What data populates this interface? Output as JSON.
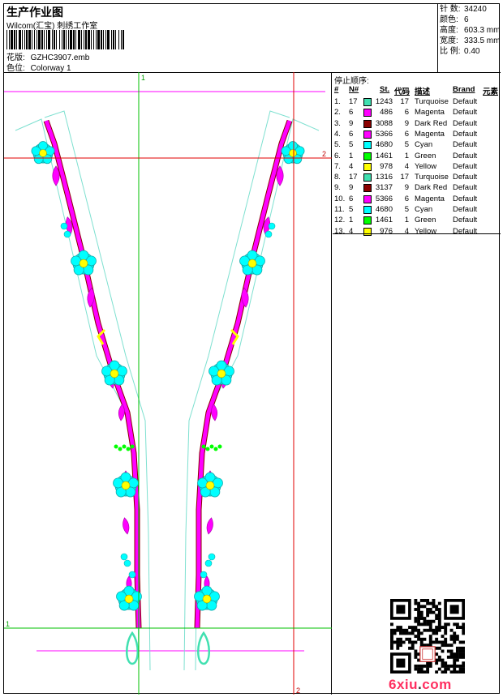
{
  "header": {
    "title": "生产作业图",
    "subtitle": "Wilcom(汇宝) 刺绣工作室",
    "design_label": "花版:",
    "design_value": "GZHC3907.emb",
    "colorway_label": "色位:",
    "colorway_value": "Colorway 1"
  },
  "stats": [
    {
      "label": "针 数:",
      "value": "34240"
    },
    {
      "label": "颜色:",
      "value": "6"
    },
    {
      "label": "高度:",
      "value": "603.3 mm"
    },
    {
      "label": "宽度:",
      "value": "333.5 mm"
    },
    {
      "label": "比 例:",
      "value": "0.40"
    }
  ],
  "stop_sequence": {
    "title": "停止顺序:",
    "columns": [
      "#",
      "N#",
      "St.",
      "代码",
      "描述",
      "Brand",
      "元素"
    ],
    "rows": [
      {
        "idx": "1.",
        "n": "17",
        "color": "#40e0b0",
        "st": "1243",
        "code": "17",
        "desc": "Turquoise",
        "brand": "Default"
      },
      {
        "idx": "2.",
        "n": "6",
        "color": "#ff00ff",
        "st": "486",
        "code": "6",
        "desc": "Magenta",
        "brand": "Default"
      },
      {
        "idx": "3.",
        "n": "9",
        "color": "#8b0000",
        "st": "3088",
        "code": "9",
        "desc": "Dark Red",
        "brand": "Default"
      },
      {
        "idx": "4.",
        "n": "6",
        "color": "#ff00ff",
        "st": "5366",
        "code": "6",
        "desc": "Magenta",
        "brand": "Default"
      },
      {
        "idx": "5.",
        "n": "5",
        "color": "#00ffff",
        "st": "4680",
        "code": "5",
        "desc": "Cyan",
        "brand": "Default"
      },
      {
        "idx": "6.",
        "n": "1",
        "color": "#00ff00",
        "st": "1461",
        "code": "1",
        "desc": "Green",
        "brand": "Default"
      },
      {
        "idx": "7.",
        "n": "4",
        "color": "#ffff00",
        "st": "978",
        "code": "4",
        "desc": "Yellow",
        "brand": "Default"
      },
      {
        "idx": "8.",
        "n": "17",
        "color": "#40e0b0",
        "st": "1316",
        "code": "17",
        "desc": "Turquoise",
        "brand": "Default"
      },
      {
        "idx": "9.",
        "n": "9",
        "color": "#8b0000",
        "st": "3137",
        "code": "9",
        "desc": "Dark Red",
        "brand": "Default"
      },
      {
        "idx": "10.",
        "n": "6",
        "color": "#ff00ff",
        "st": "5366",
        "code": "6",
        "desc": "Magenta",
        "brand": "Default"
      },
      {
        "idx": "11.",
        "n": "5",
        "color": "#00ffff",
        "st": "4680",
        "code": "5",
        "desc": "Cyan",
        "brand": "Default"
      },
      {
        "idx": "12.",
        "n": "1",
        "color": "#00ff00",
        "st": "1461",
        "code": "1",
        "desc": "Green",
        "brand": "Default"
      },
      {
        "idx": "13.",
        "n": "4",
        "color": "#ffff00",
        "st": "976",
        "code": "4",
        "desc": "Yellow",
        "brand": "Default"
      }
    ]
  },
  "guides": {
    "v1": "1",
    "v2": "2",
    "h1": "1",
    "h2": "2"
  },
  "watermark": {
    "site": "6xiu",
    "dot": ".",
    "tld": "com"
  },
  "colors": {
    "magenta": "#ff00ff",
    "cyan": "#00ffff",
    "yellow": "#ffff00",
    "green": "#00ff00",
    "turquoise": "#40e0b0",
    "darkred": "#8b0000",
    "guide_green": "#00c000",
    "guide_red": "#e00000"
  }
}
